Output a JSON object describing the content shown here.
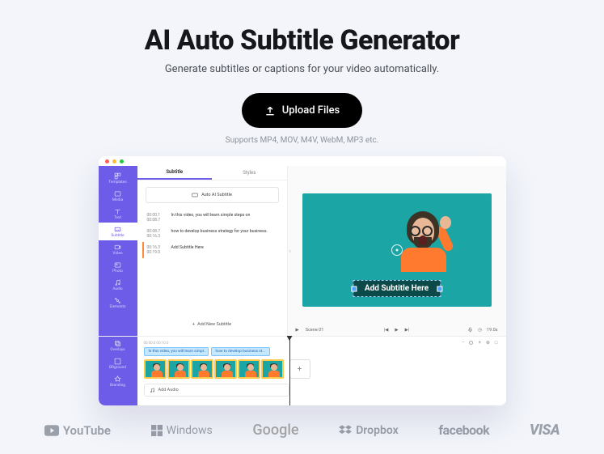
{
  "hero": {
    "title": "AI Auto Subtitle Generator",
    "subtitle": "Generate subtitles or captions for your video automatically.",
    "upload_label": "Upload Files",
    "supports": "Supports MP4, MOV, M4V, WebM, MP3 etc."
  },
  "sidebar": {
    "items": [
      {
        "label": "Templates"
      },
      {
        "label": "Media"
      },
      {
        "label": "Text"
      },
      {
        "label": "Subtitle"
      },
      {
        "label": "Video"
      },
      {
        "label": "Photo"
      },
      {
        "label": "Audio"
      },
      {
        "label": "Elements"
      },
      {
        "label": "Overlays"
      },
      {
        "label": "BRground"
      },
      {
        "label": "Branding"
      }
    ]
  },
  "panel": {
    "tabs": [
      {
        "label": "Subtitle"
      },
      {
        "label": "Styles"
      }
    ],
    "auto_btn": "Auto AI Subtitle",
    "subs": [
      {
        "t0": "00:00.1",
        "t1": "00:08.7",
        "text": "In this video, you will learn simple steps on"
      },
      {
        "t0": "00:08.7",
        "t1": "00:16.3",
        "text": "how to develop business strategy for your business."
      },
      {
        "t0": "00:16.3",
        "t1": "00:19.0",
        "text": "Add Subtitle Here"
      }
    ],
    "add_new": "Add New Subtitle"
  },
  "preview": {
    "overlay_text": "Add Subtitle Here",
    "scene_label": "Scene 01",
    "duration": "19.0s"
  },
  "timeline": {
    "ruler": "00:00.0   00:10.0",
    "tags": [
      "In this video, you will learn simpl…",
      "how to develop business st…"
    ],
    "add_audio": "Add Audio"
  },
  "logos": {
    "youtube": "YouTube",
    "windows": "Windows",
    "google": "Google",
    "dropbox": "Dropbox",
    "facebook": "facebook",
    "visa": "VISA"
  }
}
